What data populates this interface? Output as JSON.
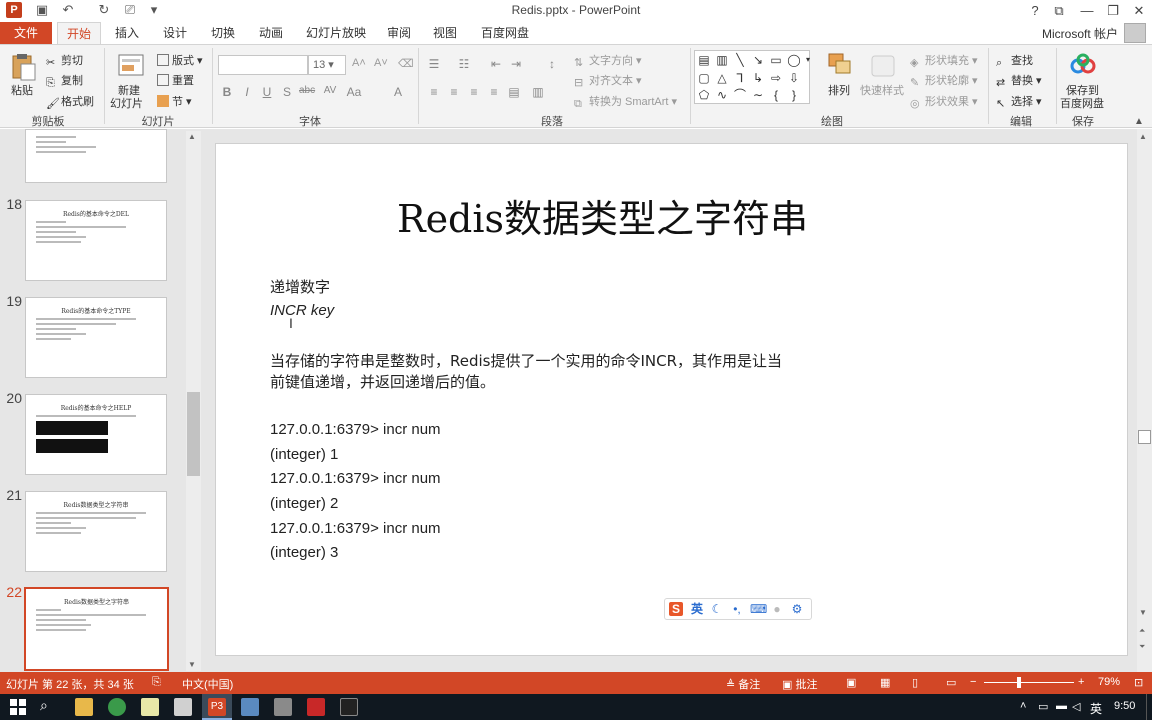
{
  "window": {
    "title": "Redis.pptx - PowerPoint",
    "help": "?",
    "minimize": "—",
    "restore": "❐",
    "close": "✕"
  },
  "tabs": {
    "file": "文件",
    "items": [
      "开始",
      "插入",
      "设计",
      "切换",
      "动画",
      "幻灯片放映",
      "审阅",
      "视图",
      "百度网盘"
    ],
    "active_index": 0,
    "account": "Microsoft 帐户"
  },
  "ribbon": {
    "clipboard": {
      "label": "剪贴板",
      "paste": "粘贴",
      "cut": "剪切",
      "copy": "复制",
      "format_painter": "格式刷"
    },
    "slides": {
      "label": "幻灯片",
      "new_slide": "新建",
      "new_slide_2": "幻灯片",
      "layout": "版式",
      "reset": "重置",
      "section": "节"
    },
    "font": {
      "label": "字体",
      "font_name": "",
      "font_size": "13"
    },
    "paragraph": {
      "label": "段落",
      "text_direction": "文字方向",
      "align_text": "对齐文本",
      "smartart": "转换为 SmartArt"
    },
    "drawing": {
      "label": "绘图",
      "arrange": "排列",
      "quick_styles": "快速样式",
      "shape_fill": "形状填充",
      "shape_outline": "形状轮廓",
      "shape_effects": "形状效果"
    },
    "editing": {
      "label": "编辑",
      "find": "查找",
      "replace": "替换",
      "select": "选择"
    },
    "save": {
      "label": "保存",
      "save_to": "保存到",
      "baidu": "百度网盘"
    }
  },
  "thumbnails": [
    {
      "number": "",
      "title": ""
    },
    {
      "number": "18",
      "title": "Redis的基本命令之DEL"
    },
    {
      "number": "19",
      "title": "Redis的基本命令之TYPE"
    },
    {
      "number": "20",
      "title": "Redis的基本命令之HELP"
    },
    {
      "number": "21",
      "title": "Redis数据类型之字符串"
    },
    {
      "number": "22",
      "title": "Redis数据类型之字符串"
    }
  ],
  "slide": {
    "title": "Redis数据类型之字符串",
    "heading": "递增数字",
    "syntax": "INCR key",
    "desc_line1": "当存储的字符串是整数时，Redis提供了一个实用的命令INCR，其作用是让当",
    "desc_line2": "前键值递增，并返回递增后的值。",
    "code": [
      "127.0.0.1:6379> incr num",
      "(integer) 1",
      "127.0.0.1:6379> incr num",
      "(integer) 2",
      "127.0.0.1:6379> incr num",
      "(integer) 3"
    ]
  },
  "ime": {
    "mode": "英"
  },
  "status": {
    "slide_info": "幻灯片 第 22 张，共 34 张",
    "language": "中文(中国)",
    "notes": "备注",
    "comments": "批注",
    "zoom": "79%"
  },
  "taskbar": {
    "ime": "英",
    "time": "9:50"
  },
  "colors": {
    "accent": "#d24726",
    "taskbar": "#101820"
  }
}
